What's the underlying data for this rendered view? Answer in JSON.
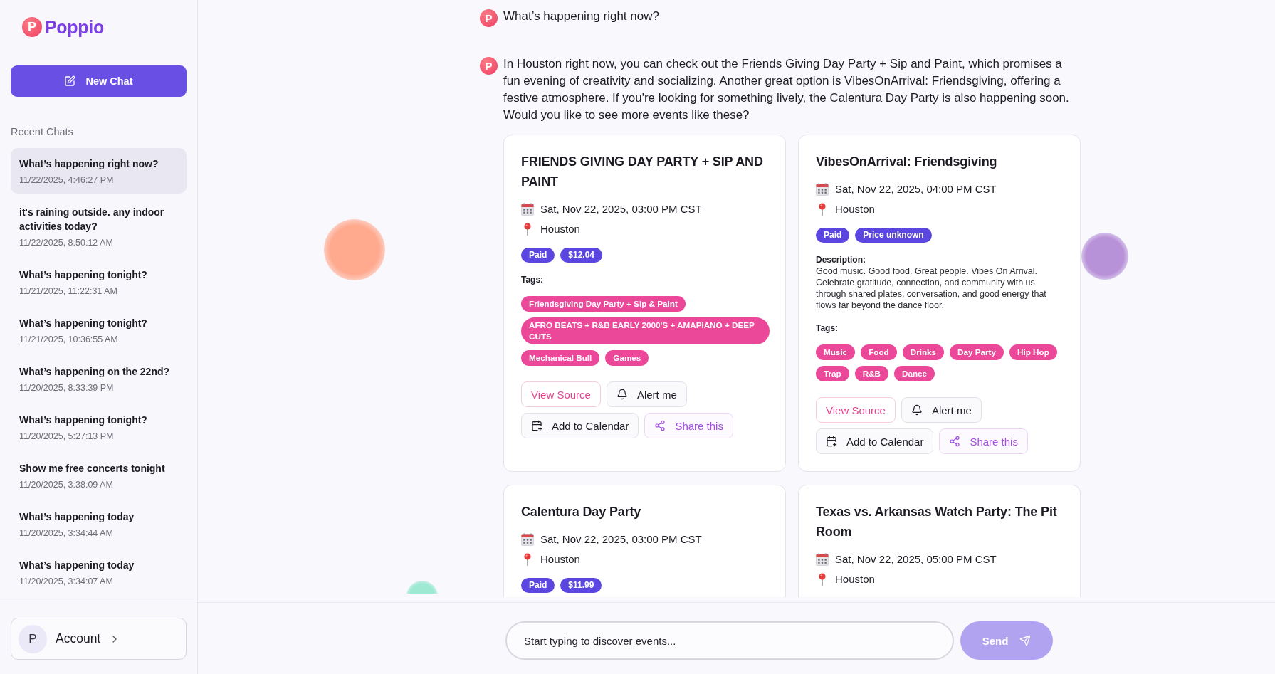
{
  "sidebar": {
    "logo": {
      "mark": "P",
      "name": "Poppio"
    },
    "new_chat_button": "New Chat",
    "section_title": "Recent Chats",
    "chats": [
      {
        "title": "What’s happening right now?",
        "time": "11/22/2025, 4:46:27 PM",
        "selected": true
      },
      {
        "title": "it's raining outside. any indoor activities today?",
        "time": "11/22/2025, 8:50:12 AM",
        "selected": false
      },
      {
        "title": "What’s happening tonight?",
        "time": "11/21/2025, 11:22:31 AM",
        "selected": false
      },
      {
        "title": "What’s happening tonight?",
        "time": "11/21/2025, 10:36:55 AM",
        "selected": false
      },
      {
        "title": "What’s happening on the 22nd?",
        "time": "11/20/2025, 8:33:39 PM",
        "selected": false
      },
      {
        "title": "What’s happening tonight?",
        "time": "11/20/2025, 5:27:13 PM",
        "selected": false
      },
      {
        "title": "Show me free concerts tonight",
        "time": "11/20/2025, 3:38:09 AM",
        "selected": false
      },
      {
        "title": "What’s happening today",
        "time": "11/20/2025, 3:34:44 AM",
        "selected": false
      },
      {
        "title": "What’s happening today",
        "time": "11/20/2025, 3:34:07 AM",
        "selected": false
      }
    ],
    "account": {
      "avatar": "P",
      "label": "Account"
    }
  },
  "messages": [
    {
      "avatar": "P",
      "text": "What’s happening right now?"
    },
    {
      "avatar": "P",
      "text": "In Houston right now, you can check out the Friends Giving Day Party + Sip and Paint, which promises a fun evening of creativity and socializing. Another great option is VibesOnArrival: Friendsgiving, offering a festive atmosphere. If you're looking for something lively, the Calentura Day Party is also happening soon. Would you like to see more events like these?",
      "events": [
        {
          "title": "FRIENDS GIVING DAY PARTY + SIP AND PAINT",
          "date": "Sat, Nov 22, 2025, 03:00 PM CST",
          "location": "Houston",
          "badges": [
            "Paid",
            "$12.04"
          ],
          "tags_label": "Tags:",
          "tags": [
            "Friendsgiving Day Party + Sip & Paint",
            "AFRO BEATS + R&B EARLY 2000'S + AMAPIANO + DEEP CUTS",
            "Mechanical Bull",
            "Games"
          ],
          "actions": [
            {
              "kind": "source",
              "label": "View Source"
            },
            {
              "kind": "alert",
              "label": "Alert me"
            },
            {
              "kind": "calendar",
              "label": "Add to Calendar"
            },
            {
              "kind": "share",
              "label": "Share this"
            }
          ]
        },
        {
          "title": "VibesOnArrival: Friendsgiving",
          "date": "Sat, Nov 22, 2025, 04:00 PM CST",
          "location": "Houston",
          "badges": [
            "Paid",
            "Price unknown"
          ],
          "description_label": "Description:",
          "description": "Good music. Good food. Great people. Vibes On Arrival. Celebrate gratitude, connection, and community with us through shared plates, conversation, and good energy that flows far beyond the dance floor.",
          "tags_label": "Tags:",
          "tags": [
            "Music",
            "Food",
            "Drinks",
            "Day Party",
            "Hip Hop",
            "Trap",
            "R&B",
            "Dance"
          ],
          "actions": [
            {
              "kind": "source",
              "label": "View Source"
            },
            {
              "kind": "alert",
              "label": "Alert me"
            },
            {
              "kind": "calendar",
              "label": "Add to Calendar"
            },
            {
              "kind": "share",
              "label": "Share this"
            }
          ]
        },
        {
          "title": "Calentura Day Party",
          "date": "Sat, Nov 22, 2025, 03:00 PM CST",
          "location": "Houston",
          "badges": [
            "Paid",
            "$11.99"
          ]
        },
        {
          "title": "Texas vs. Arkansas Watch Party: The Pit Room",
          "date": "Sat, Nov 22, 2025, 05:00 PM CST",
          "location": "Houston"
        }
      ]
    }
  ],
  "composer": {
    "placeholder": "Start typing to discover events...",
    "send_button": {
      "label": "Send",
      "disabled": true
    }
  }
}
